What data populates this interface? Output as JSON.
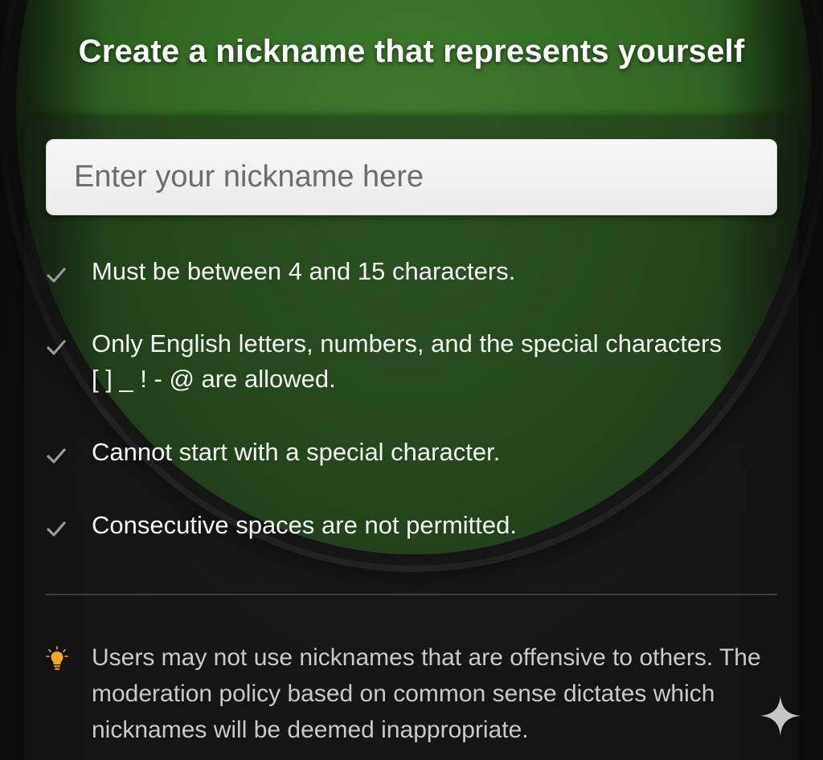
{
  "header": {
    "title": "Create a nickname that represents yourself"
  },
  "nickname_input": {
    "placeholder": "Enter your nickname here",
    "value": ""
  },
  "rules": [
    {
      "icon": "check-icon",
      "text": "Must be between 4 and 15 characters."
    },
    {
      "icon": "check-icon",
      "text": "Only English letters, numbers, and the special characters [ ] _ ! - @ are allowed."
    },
    {
      "icon": "check-icon",
      "text": "Cannot start with a special character."
    },
    {
      "icon": "check-icon",
      "text": "Consecutive spaces are not permitted."
    }
  ],
  "notice": {
    "icon": "lightbulb-icon",
    "text": "Users may not use nicknames that are offensive to others. The moderation policy based on common sense dictates which nicknames will be deemed inappropriate."
  },
  "decor": {
    "corner_icon": "sparkle-icon"
  },
  "colors": {
    "table_felt": "#3f7a2e",
    "check": "#9a9a9a",
    "bulb": "#f5a623",
    "rule_text": "#f4f4f4",
    "notice_text": "#c9c9c9"
  }
}
